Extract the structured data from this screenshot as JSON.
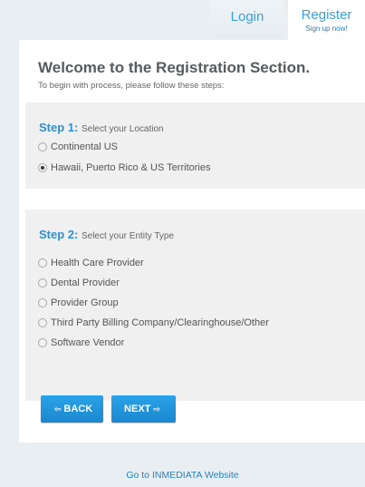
{
  "tabs": {
    "login": "Login",
    "register": "Register",
    "register_sub": "Sign up now!"
  },
  "header": {
    "title": "Welcome to the Registration Section.",
    "subtitle": "To begin with process, please follow these steps:"
  },
  "step1": {
    "number": "Step 1:",
    "label": "Select your Location",
    "options": [
      {
        "label": "Continental US",
        "checked": false
      },
      {
        "label": "Hawaii, Puerto Rico & US Territories",
        "checked": true
      }
    ]
  },
  "step2": {
    "number": "Step 2:",
    "label": "Select your Entity Type",
    "options": [
      {
        "label": "Health Care Provider",
        "checked": false
      },
      {
        "label": "Dental Provider",
        "checked": false
      },
      {
        "label": "Provider Group",
        "checked": false
      },
      {
        "label": "Third Party Billing Company/Clearinghouse/Other",
        "checked": false
      },
      {
        "label": "Software Vendor",
        "checked": false
      }
    ]
  },
  "buttons": {
    "back": "BACK",
    "next": "NEXT",
    "back_arrow": "⇦",
    "next_arrow": "⇨"
  },
  "footer": {
    "link": "Go to INMEDIATA Website"
  },
  "colors": {
    "accent": "#2f8fcf",
    "button": "#1b87cf",
    "background": "#e9eef2"
  }
}
